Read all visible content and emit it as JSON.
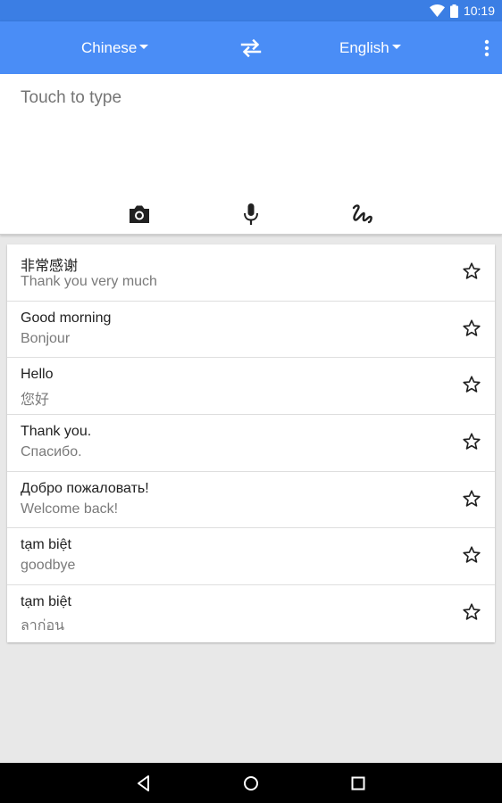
{
  "status_bar": {
    "time": "10:19",
    "icons": [
      "wifi-icon",
      "battery-icon"
    ]
  },
  "toolbar": {
    "source_language": "Chinese",
    "target_language": "English",
    "icons": [
      "swap-languages-icon",
      "more-vert-icon"
    ]
  },
  "input": {
    "placeholder": "Touch to type",
    "tools": [
      "camera-icon",
      "microphone-icon",
      "handwriting-icon"
    ]
  },
  "history": [
    {
      "source": "非常感谢",
      "translation": "Thank you very much"
    },
    {
      "source": "Good morning",
      "translation": "Bonjour"
    },
    {
      "source": "Hello",
      "translation": "您好"
    },
    {
      "source": "Thank you.",
      "translation": "Спасибо."
    },
    {
      "source": "Добро пожаловать!",
      "translation": "Welcome back!"
    },
    {
      "source": "tạm biệt",
      "translation": "goodbye"
    },
    {
      "source": "tạm biệt",
      "translation": "ลาก่อน"
    }
  ],
  "navbar": {
    "icons": [
      "back-icon",
      "home-icon",
      "recents-icon"
    ]
  },
  "colors": {
    "status_bar": "#3b7ee4",
    "toolbar": "#4a8df6",
    "background": "#e8e8e8"
  }
}
